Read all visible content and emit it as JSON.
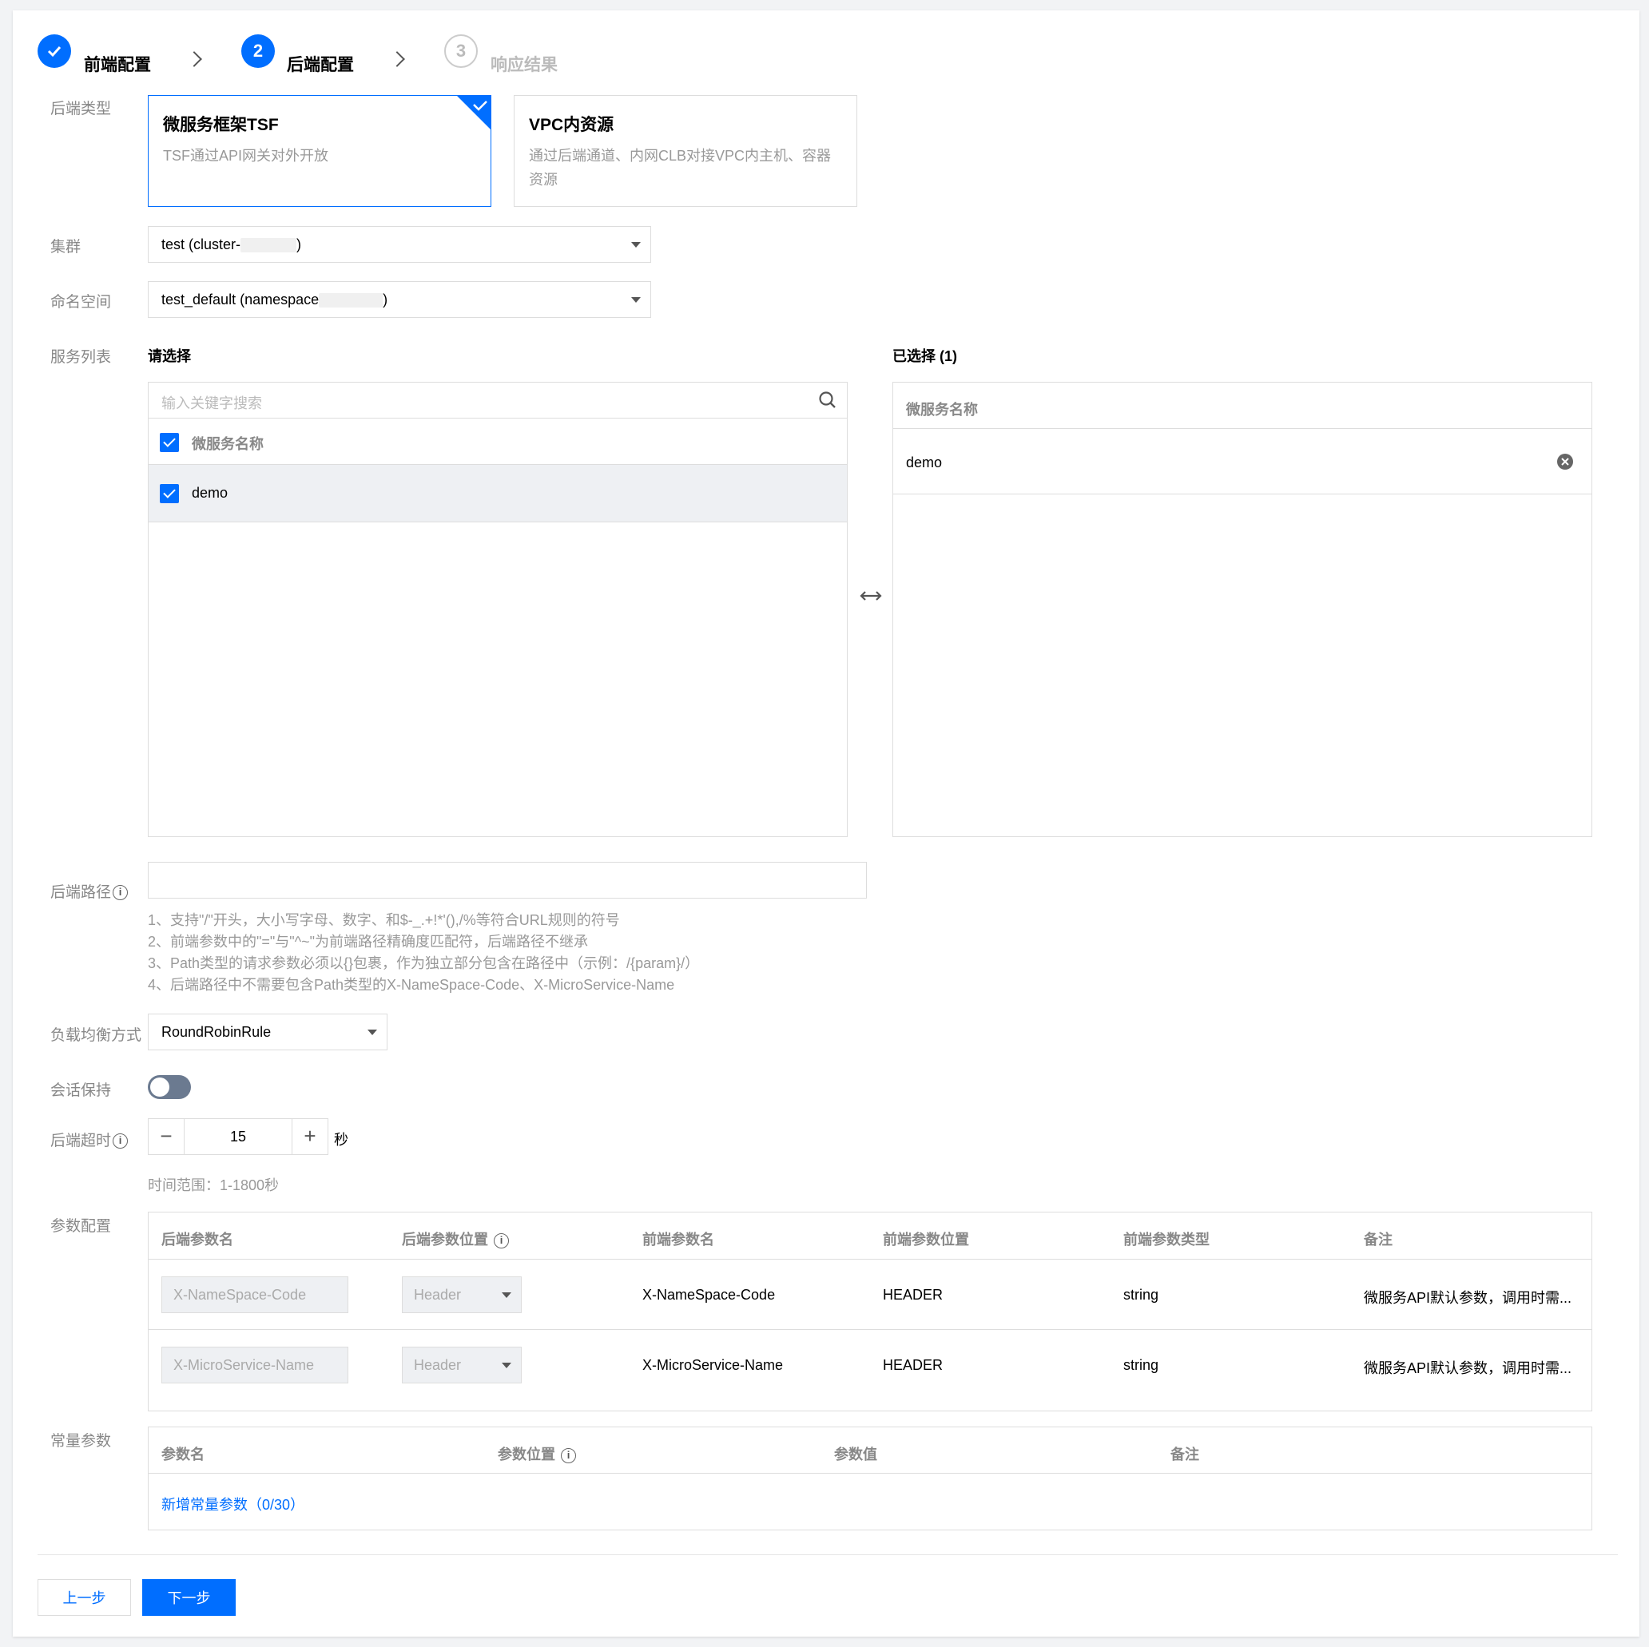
{
  "steps": [
    {
      "num": "✓",
      "label": "前端配置",
      "state": "done"
    },
    {
      "num": "2",
      "label": "后端配置",
      "state": "active"
    },
    {
      "num": "3",
      "label": "响应结果",
      "state": "pending"
    }
  ],
  "backend_type": {
    "label": "后端类型",
    "options": [
      {
        "title": "微服务框架TSF",
        "desc": "TSF通过API网关对外开放",
        "selected": true
      },
      {
        "title": "VPC内资源",
        "desc": "通过后端通道、内网CLB对接VPC内主机、容器资源",
        "selected": false
      }
    ]
  },
  "cluster": {
    "label": "集群",
    "value_prefix": "test (cluster-",
    "value_suffix": ")"
  },
  "namespace": {
    "label": "命名空间",
    "value_prefix": "test_default (namespace",
    "value_suffix": ")"
  },
  "services": {
    "label": "服务列表",
    "left_title": "请选择",
    "right_title": "已选择 (1)",
    "search_placeholder": "输入关键字搜索",
    "column_header": "微服务名称",
    "items": [
      "demo"
    ],
    "selected": [
      "demo"
    ]
  },
  "backend_path": {
    "label": "后端路径",
    "value": "",
    "hints": [
      "1、支持\"/\"开头，大小写字母、数字、和$-_.+!*'(),/%等符合URL规则的符号",
      "2、前端参数中的\"=\"与\"^~\"为前端路径精确度匹配符，后端路径不继承",
      "3、Path类型的请求参数必须以{}包裹，作为独立部分包含在路径中（示例：/{param}/）",
      "4、后端路径中不需要包含Path类型的X-NameSpace-Code、X-MicroService-Name"
    ]
  },
  "load_balance": {
    "label": "负载均衡方式",
    "value": "RoundRobinRule"
  },
  "session": {
    "label": "会话保持",
    "enabled": false
  },
  "timeout": {
    "label": "后端超时",
    "value": "15",
    "unit": "秒",
    "hint": "时间范围：1-1800秒",
    "minus": "−",
    "plus": "+"
  },
  "params": {
    "label": "参数配置",
    "headers": [
      "后端参数名",
      "后端参数位置",
      "前端参数名",
      "前端参数位置",
      "前端参数类型",
      "备注"
    ],
    "rows": [
      {
        "backend_name": "X-NameSpace-Code",
        "backend_pos": "Header",
        "frontend_name": "X-NameSpace-Code",
        "frontend_pos": "HEADER",
        "type": "string",
        "note": "微服务API默认参数，调用时需..."
      },
      {
        "backend_name": "X-MicroService-Name",
        "backend_pos": "Header",
        "frontend_name": "X-MicroService-Name",
        "frontend_pos": "HEADER",
        "type": "string",
        "note": "微服务API默认参数，调用时需..."
      }
    ]
  },
  "constants": {
    "label": "常量参数",
    "headers": [
      "参数名",
      "参数位置",
      "参数值",
      "备注"
    ],
    "add_link": "新增常量参数（0/30）"
  },
  "footer": {
    "prev": "上一步",
    "next": "下一步"
  },
  "colors": {
    "primary": "#006eff",
    "border": "#dddddd",
    "muted": "#888888"
  }
}
